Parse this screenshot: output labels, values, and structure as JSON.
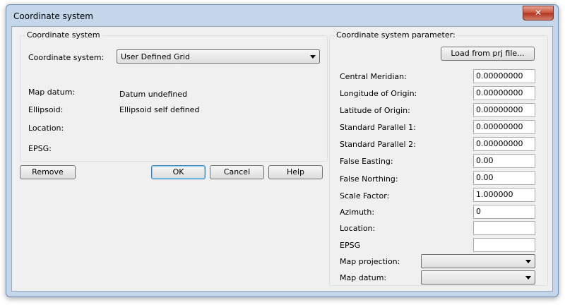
{
  "window": {
    "title": "Coordinate system",
    "close_glyph": "✕"
  },
  "left_group": {
    "title": "Coordinate system",
    "cs_label": "Coordinate system:",
    "cs_value": "User Defined Grid",
    "map_datum_label": "Map datum:",
    "map_datum_value": "Datum undefined",
    "ellipsoid_label": "Ellipsoid:",
    "ellipsoid_value": "Ellipsoid self defined",
    "location_label": "Location:",
    "epsg_label": "EPSG:"
  },
  "buttons": {
    "remove": "Remove",
    "ok": "OK",
    "cancel": "Cancel",
    "help": "Help"
  },
  "right_group": {
    "title": "Coordinate system parameter:",
    "load_button": "Load from prj file...",
    "params": {
      "central_meridian": {
        "label": "Central Meridian:",
        "value": "0.00000000"
      },
      "longitude_of_origin": {
        "label": "Longitude of Origin:",
        "value": "0.00000000"
      },
      "latitude_of_origin": {
        "label": "Latitude of Origin:",
        "value": "0.00000000"
      },
      "standard_parallel_1": {
        "label": "Standard Parallel 1:",
        "value": "0.00000000"
      },
      "standard_parallel_2": {
        "label": "Standard Parallel 2:",
        "value": "0.00000000"
      },
      "false_easting": {
        "label": "False Easting:",
        "value": "0.00"
      },
      "false_northing": {
        "label": "False Northing:",
        "value": "0.00"
      },
      "scale_factor": {
        "label": "Scale Factor:",
        "value": "1.000000"
      },
      "azimuth": {
        "label": "Azimuth:",
        "value": "0"
      },
      "location": {
        "label": "Location:",
        "value": ""
      },
      "epsg": {
        "label": "EPSG",
        "value": ""
      }
    },
    "map_projection_label": "Map projection:",
    "map_projection_value": "",
    "map_datum_label": "Map datum:",
    "map_datum_value": ""
  }
}
